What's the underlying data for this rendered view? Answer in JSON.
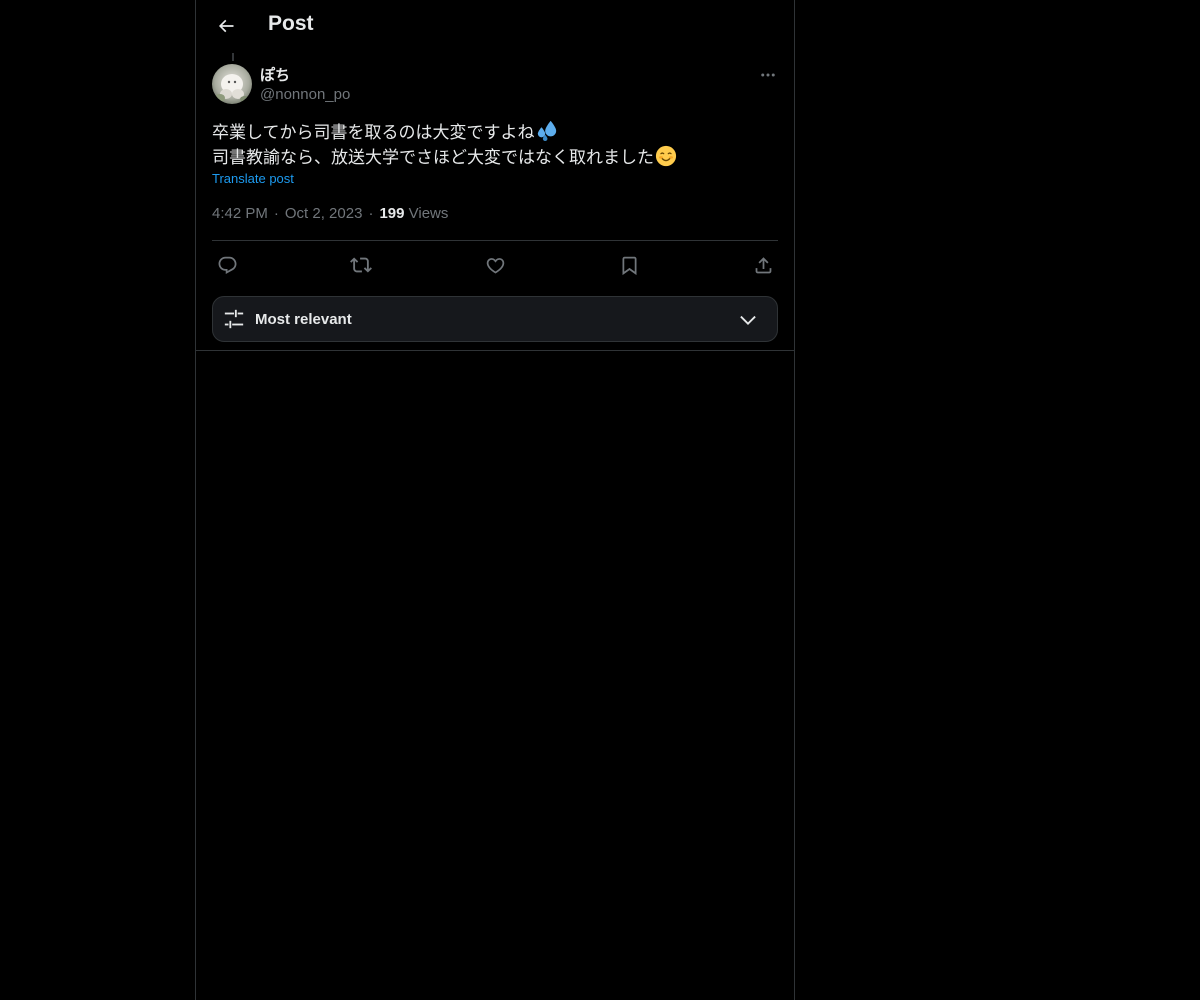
{
  "header": {
    "title": "Post",
    "back_icon": "arrow-left-icon"
  },
  "post": {
    "author_name": "ぽち",
    "author_handle": "@nonnon_po",
    "text_line_1": "卒業してから司書を取るのは大変ですよね",
    "text_line_1_emoji": "sweat-droplets-emoji",
    "text_line_2": "司書教諭なら、放送大学でさほど大変ではなく取れました",
    "text_line_2_emoji": "smiling-face-emoji",
    "translate_label": "Translate post",
    "time": "4:42 PM",
    "date": "Oct 2, 2023",
    "views_count": "199",
    "views_label": "Views"
  },
  "actions": {
    "reply_icon": "reply-icon",
    "repost_icon": "repost-icon",
    "like_icon": "heart-icon",
    "bookmark_icon": "bookmark-icon",
    "share_icon": "share-icon"
  },
  "replies_sort": {
    "selected": "Most relevant",
    "icon": "sliders-icon"
  },
  "colors": {
    "background": "#000000",
    "text_primary": "#e7e9ea",
    "text_secondary": "#71767b",
    "link": "#1d9bf0",
    "border": "#2f3336",
    "sort_box_bg": "#16181c"
  }
}
